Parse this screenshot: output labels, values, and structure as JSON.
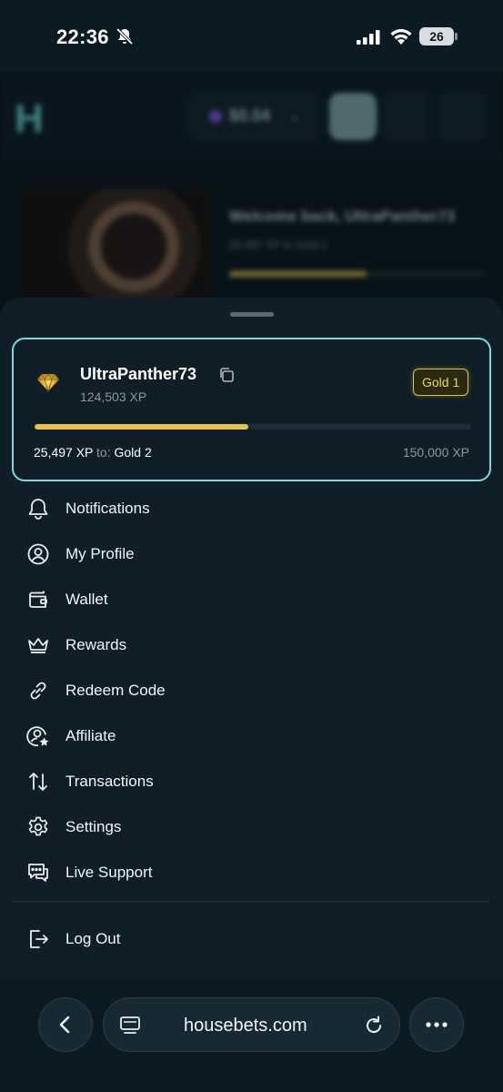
{
  "status_bar": {
    "time": "22:36",
    "battery": "26"
  },
  "background": {
    "logo": "H",
    "balance": "$0.04",
    "welcome": "Welcome back, UltraPanther73",
    "xp_line": "25,497 XP to Gold 2"
  },
  "profile": {
    "username": "UltraPanther73",
    "xp_total": "124,503 XP",
    "rank": "Gold 1",
    "progress_fraction": 0.49,
    "progress_current": "25,497 XP",
    "progress_to_label": "to:",
    "progress_next_rank": "Gold 2",
    "progress_target": "150,000 XP",
    "accent": "#7fd9dc",
    "gold": "#e6c14c"
  },
  "menu": {
    "items": [
      {
        "label": "Notifications",
        "icon": "bell-icon"
      },
      {
        "label": "My Profile",
        "icon": "user-circle-icon"
      },
      {
        "label": "Wallet",
        "icon": "wallet-icon"
      },
      {
        "label": "Rewards",
        "icon": "crown-icon"
      },
      {
        "label": "Redeem Code",
        "icon": "link-icon"
      },
      {
        "label": "Affiliate",
        "icon": "user-star-icon"
      },
      {
        "label": "Transactions",
        "icon": "arrows-updown-icon"
      },
      {
        "label": "Settings",
        "icon": "gear-icon"
      },
      {
        "label": "Live Support",
        "icon": "chat-icon"
      }
    ],
    "logout": {
      "label": "Log Out",
      "icon": "logout-icon"
    }
  },
  "browser": {
    "url": "housebets.com"
  }
}
